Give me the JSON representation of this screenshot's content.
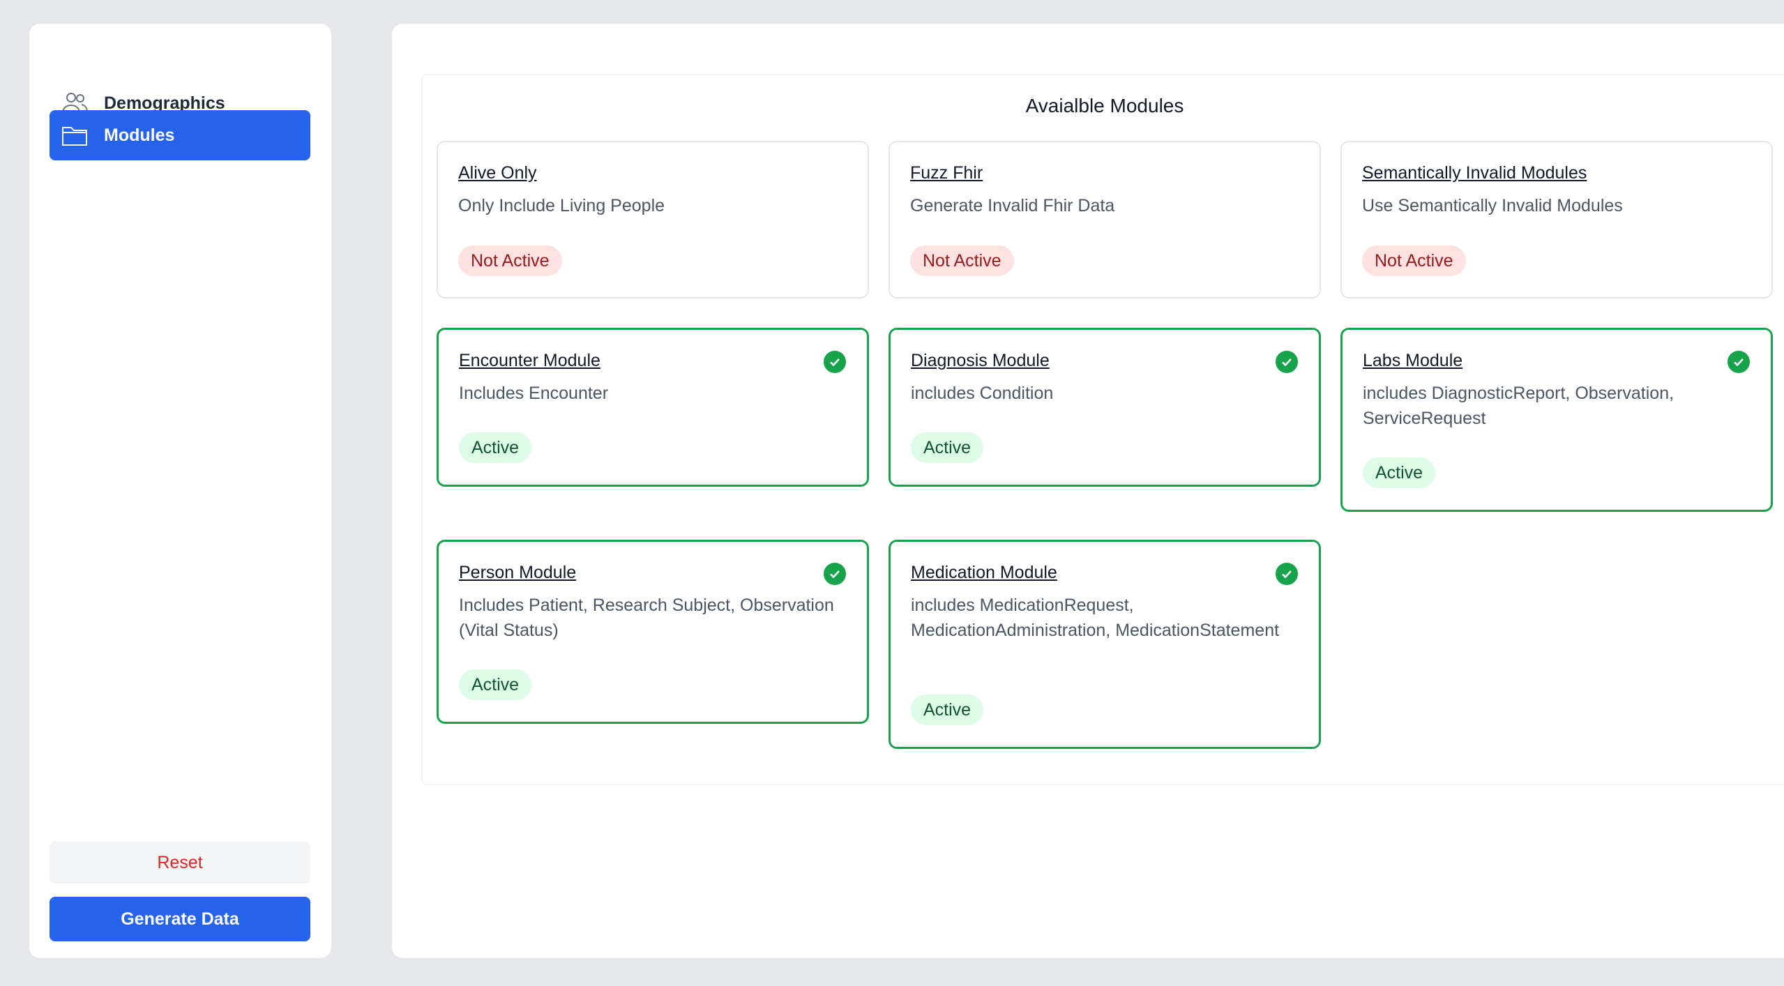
{
  "sidebar": {
    "items": [
      {
        "label": "Demographics",
        "icon": "users-icon"
      },
      {
        "label": "Modules",
        "icon": "folder-icon"
      }
    ],
    "reset_label": "Reset",
    "generate_label": "Generate Data"
  },
  "main": {
    "title": "Avaialble Modules",
    "modules": [
      {
        "title": "Alive Only",
        "description": "Only Include Living People",
        "status": "Not Active"
      },
      {
        "title": "Fuzz Fhir",
        "description": "Generate Invalid Fhir Data",
        "status": "Not Active"
      },
      {
        "title": "Semantically Invalid Modules",
        "description": "Use Semantically Invalid Modules",
        "status": "Not Active"
      },
      {
        "title": "Encounter Module",
        "description": "Includes Encounter",
        "status": "Active"
      },
      {
        "title": "Diagnosis Module",
        "description": "includes Condition",
        "status": "Active"
      },
      {
        "title": "Labs Module",
        "description": "includes DiagnosticReport, Observation, ServiceRequest",
        "status": "Active"
      },
      {
        "title": "Person Module",
        "description": "Includes Patient, Research Subject, Observation (Vital Status)",
        "status": "Active"
      },
      {
        "title": "Medication Module",
        "description": "includes MedicationRequest, MedicationAdministration, MedicationStatement",
        "status": "Active"
      }
    ]
  },
  "colors": {
    "primary": "#2563eb",
    "active_border": "#16a34a",
    "danger": "#dc2626"
  }
}
